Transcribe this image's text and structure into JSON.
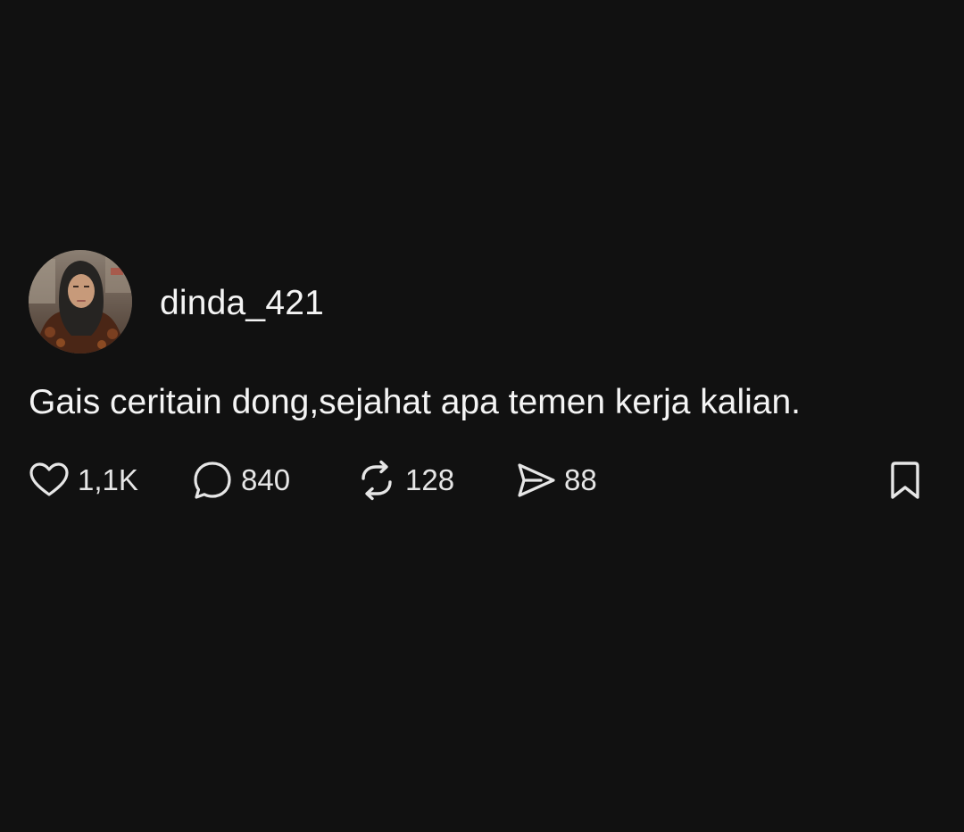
{
  "post": {
    "username": "dinda_421",
    "text": "Gais ceritain dong,sejahat apa temen kerja kalian.",
    "avatar_icon": "profile-photo"
  },
  "actions": {
    "like": {
      "icon": "heart-icon",
      "count": "1,1K"
    },
    "comment": {
      "icon": "speech-bubble-icon",
      "count": "840"
    },
    "repost": {
      "icon": "repost-icon",
      "count": "128"
    },
    "share": {
      "icon": "paper-plane-icon",
      "count": "88"
    },
    "bookmark": {
      "icon": "bookmark-icon"
    }
  },
  "colors": {
    "background": "#111111",
    "text": "#f4f4f4",
    "icon": "#e6e6e6"
  }
}
